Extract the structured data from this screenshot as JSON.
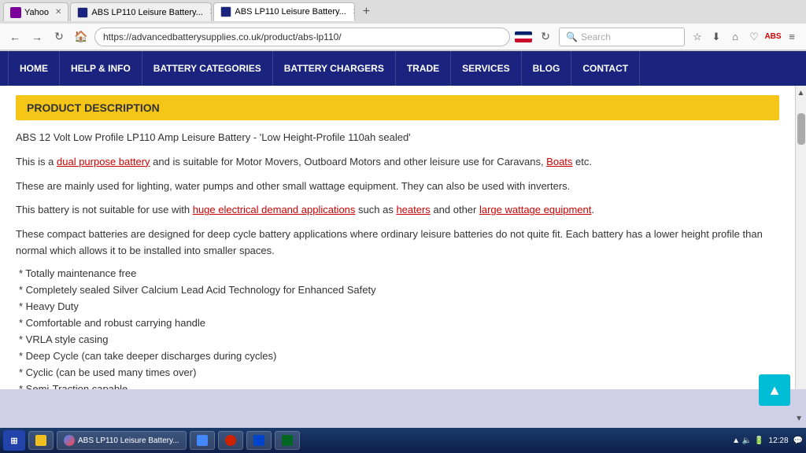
{
  "browser": {
    "tabs": [
      {
        "id": "yahoo",
        "label": "Yahoo",
        "favicon": "yahoo",
        "active": false
      },
      {
        "id": "abs1",
        "label": "ABS LP110 Leisure Battery...",
        "favicon": "abs",
        "active": false
      },
      {
        "id": "abs2",
        "label": "ABS LP110 Leisure Battery...",
        "favicon": "abs",
        "active": true
      }
    ],
    "url": "https://advancedbatterysupplies.co.uk/product/abs-lp110/",
    "search_placeholder": "Search"
  },
  "nav": {
    "items": [
      {
        "id": "home",
        "label": "HOME"
      },
      {
        "id": "help",
        "label": "HELP & INFO"
      },
      {
        "id": "battery-cat",
        "label": "BATTERY CATEGORIES"
      },
      {
        "id": "battery-charge",
        "label": "BATTERY CHARGERS"
      },
      {
        "id": "trade",
        "label": "TRADE"
      },
      {
        "id": "services",
        "label": "SERVICES"
      },
      {
        "id": "blog",
        "label": "BLOG"
      },
      {
        "id": "contact",
        "label": "CONTACT"
      }
    ]
  },
  "page": {
    "section_title": "PRODUCT DESCRIPTION",
    "paragraphs": [
      {
        "id": "p1",
        "text": "ABS 12 Volt Low Profile LP110 Amp Leisure Battery - 'Low Height-Profile 110ah sealed'"
      },
      {
        "id": "p2",
        "text_parts": [
          {
            "type": "normal",
            "text": "This is a "
          },
          {
            "type": "link",
            "text": "dual purpose battery"
          },
          {
            "type": "normal",
            "text": " and is suitable for Motor Movers, Outboard Motors and other leisure use for Caravans, "
          },
          {
            "type": "link",
            "text": "Boats"
          },
          {
            "type": "normal",
            "text": " etc."
          }
        ]
      },
      {
        "id": "p3",
        "text": "These are mainly used for lighting, water pumps and other small wattage equipment. They can also be used with inverters."
      },
      {
        "id": "p4",
        "text_parts": [
          {
            "type": "normal",
            "text": "This battery is not suitable for use with "
          },
          {
            "type": "link",
            "text": "huge electrical demand applications"
          },
          {
            "type": "normal",
            "text": " such as "
          },
          {
            "type": "link",
            "text": "heaters"
          },
          {
            "type": "normal",
            "text": " and other "
          },
          {
            "type": "link",
            "text": "large wattage equipment"
          },
          {
            "type": "normal",
            "text": "."
          }
        ]
      },
      {
        "id": "p5",
        "text": "These compact batteries are designed for deep cycle battery applications where ordinary leisure batteries do not quite fit. Each battery has a lower height profile than normal which allows it to be installed into smaller spaces."
      }
    ],
    "features": [
      "* Totally maintenance free",
      "* Completely sealed Silver Calcium Lead Acid Technology for Enhanced Safety",
      "* Heavy Duty",
      "* Comfortable and robust carrying handle",
      "* VRLA style casing",
      "* Deep Cycle (can take deeper discharges during cycles)",
      "* Cyclic (can be used many times over)",
      "* Semi-Traction capable"
    ]
  },
  "taskbar": {
    "time": "12:28",
    "start_label": "⊞",
    "open_apps": [
      {
        "id": "explorer",
        "label": ""
      },
      {
        "id": "firefox",
        "label": "ABS LP110 Leisure Battery..."
      }
    ]
  }
}
